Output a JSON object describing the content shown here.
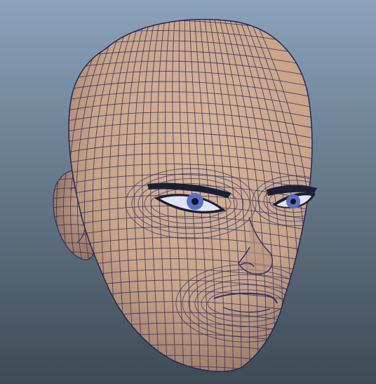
{
  "viewport": {
    "background_top": "#8aa3bb",
    "background_bottom": "#3e4a55"
  },
  "model": {
    "name": "head-mesh",
    "display": "wireframe-on-shaded",
    "skin_color": "#c9a487",
    "skin_shadow": "#8f6e5a",
    "wire_color": "#2b2f6e",
    "eye_white": "#dfe3f2",
    "iris_color": "#5a6fc2",
    "pupil_color": "#101426"
  }
}
